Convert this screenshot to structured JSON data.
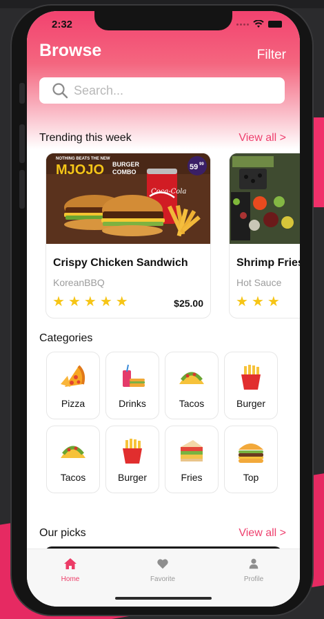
{
  "status": {
    "time": "2:32"
  },
  "header": {
    "title": "Browse",
    "filter_label": "Filter"
  },
  "search": {
    "placeholder": "Search..."
  },
  "trending": {
    "title": "Trending this week",
    "view_all": "View all >",
    "cards": [
      {
        "name": "Crispy Chicken Sandwich",
        "restaurant": "KoreanBBQ",
        "price": "$25.00",
        "rating": 5,
        "ad_text": {
          "headline": "NOTHING BEATS THE NEW",
          "brand": "MJOJO",
          "combo_top": "BURGER",
          "combo_bottom": "COMBO",
          "badge": "59",
          "badge_cents": "99",
          "can": "Coca-Cola"
        }
      },
      {
        "name": "Shrimp Fries",
        "restaurant": "Hot Sauce",
        "rating": 3
      }
    ]
  },
  "categories": {
    "title": "Categories",
    "items": [
      "Pizza",
      "Drinks",
      "Tacos",
      "Burger",
      "Tacos",
      "Burger",
      "Fries",
      "Top"
    ]
  },
  "picks": {
    "title": "Our picks",
    "view_all": "View all >"
  },
  "tabs": [
    {
      "label": "Home",
      "icon": "home-icon",
      "active": true
    },
    {
      "label": "Favorite",
      "icon": "heart-icon",
      "active": false
    },
    {
      "label": "Profile",
      "icon": "person-icon",
      "active": false
    }
  ],
  "colors": {
    "accent": "#EE3F6D",
    "star": "#F6C516"
  }
}
